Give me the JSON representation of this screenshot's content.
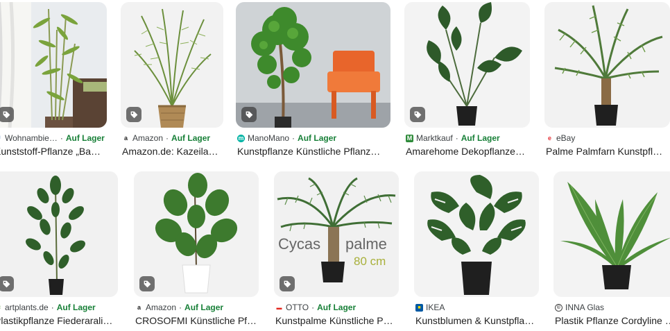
{
  "results": [
    {
      "source": "Wohnambie…",
      "stock": "Auf Lager",
      "title": "Kunststoff-Pflanze „Ba…",
      "icon": "wohnambiente-icon",
      "color": "#4a7cc2"
    },
    {
      "source": "Amazon",
      "stock": "Auf Lager",
      "title": "Amazon.de: Kazeila…",
      "icon": "amazon-icon",
      "color": "#222222"
    },
    {
      "source": "ManoMano",
      "stock": "Auf Lager",
      "title": "Kunstpflanze Künstliche Pflanz…",
      "icon": "manomano-icon",
      "color": "#00b3a4"
    },
    {
      "source": "Marktkauf",
      "stock": "Auf Lager",
      "title": "Amarehome Dekopflanze…",
      "icon": "marktkauf-icon",
      "color": "#2e8b3a"
    },
    {
      "source": "eBay",
      "stock": "",
      "title": "Palme Palmfarn Kunstpfl…",
      "icon": "ebay-icon",
      "color": "#e53238"
    },
    {
      "source": "artplants.de",
      "stock": "Auf Lager",
      "title": "Plastikpflanze Fiederarali…",
      "icon": "artplants-icon",
      "color": "#6aa84f"
    },
    {
      "source": "Amazon",
      "stock": "Auf Lager",
      "title": "CROSOFMI Künstliche Pf…",
      "icon": "amazon-icon",
      "color": "#222222"
    },
    {
      "source": "OTTO",
      "stock": "Auf Lager",
      "title": "Kunstpalme Künstliche P…",
      "icon": "otto-icon",
      "color": "#e3241b"
    },
    {
      "source": "IKEA",
      "stock": "",
      "title": "Kunstblumen & Kunstpfla…",
      "icon": "ikea-icon",
      "color": "#0058a3"
    },
    {
      "source": "INNA Glas",
      "stock": "",
      "title": "Plastik Pflanze Cordyline …",
      "icon": "inna-glas-icon",
      "color": "#444444"
    }
  ],
  "overlay_text": {
    "cycas": "Cycas",
    "palme": "palme",
    "size": "80 cm"
  },
  "separator": "·"
}
